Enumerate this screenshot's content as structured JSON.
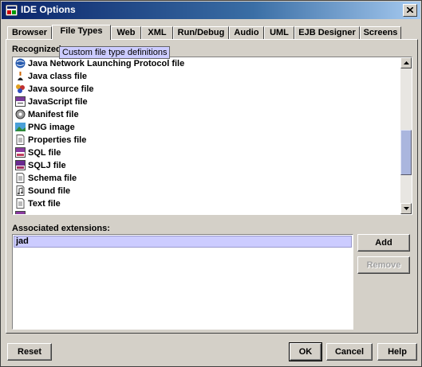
{
  "window": {
    "title": "IDE Options"
  },
  "tabs": [
    {
      "label": "Browser"
    },
    {
      "label": "File Types",
      "active": true
    },
    {
      "label": "Web"
    },
    {
      "label": "XML"
    },
    {
      "label": "Run/Debug"
    },
    {
      "label": "Audio"
    },
    {
      "label": "UML"
    },
    {
      "label": "EJB Designer"
    },
    {
      "label": "Screens"
    }
  ],
  "file_types": {
    "label": "Recognized",
    "tooltip": "Custom file type definitions",
    "items": [
      {
        "label": "Java Network Launching Protocol file",
        "icon": "jnlp-globe-icon"
      },
      {
        "label": "Java class file",
        "icon": "java-class-icon"
      },
      {
        "label": "Java source file",
        "icon": "java-source-icon"
      },
      {
        "label": "JavaScript file",
        "icon": "javascript-file-icon"
      },
      {
        "label": "Manifest file",
        "icon": "manifest-gear-icon"
      },
      {
        "label": "PNG image",
        "icon": "png-image-icon"
      },
      {
        "label": "Properties file",
        "icon": "properties-file-icon"
      },
      {
        "label": "SQL file",
        "icon": "sql-file-icon"
      },
      {
        "label": "SQLJ file",
        "icon": "sqlj-file-icon"
      },
      {
        "label": "Schema file",
        "icon": "schema-file-icon"
      },
      {
        "label": "Sound file",
        "icon": "sound-file-icon"
      },
      {
        "label": "Text file",
        "icon": "text-file-icon"
      }
    ]
  },
  "extensions": {
    "label": "Associated extensions:",
    "items": [
      "jad"
    ],
    "add_label": "Add",
    "remove_label": "Remove"
  },
  "footer": {
    "reset_label": "Reset",
    "ok_label": "OK",
    "cancel_label": "Cancel",
    "help_label": "Help"
  },
  "colors": {
    "titlebar_start": "#0a246a",
    "selection": "#ccccff",
    "tooltip_bg": "#ccccff",
    "scroll_thumb": "#aab6de"
  }
}
